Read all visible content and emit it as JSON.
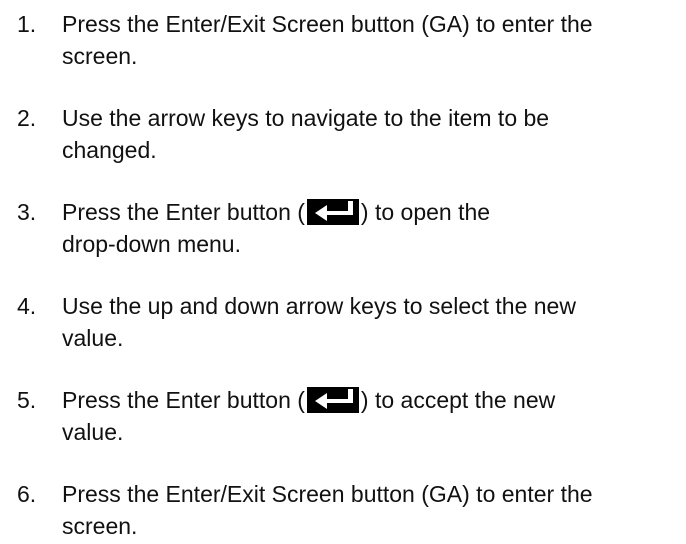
{
  "steps": [
    {
      "number": "1.",
      "lines": [
        "Press the Enter/Exit Screen button (GA) to enter the",
        "screen."
      ]
    },
    {
      "number": "2.",
      "lines": [
        "Use the arrow keys to navigate to the item to be",
        "changed."
      ]
    },
    {
      "number": "3.",
      "before_icon": "Press the Enter button (",
      "after_icon": ") to open the",
      "line2": "drop-down menu.",
      "icon": "enter-key-icon"
    },
    {
      "number": "4.",
      "lines": [
        "Use the up and down arrow keys to select the new",
        "value."
      ]
    },
    {
      "number": "5.",
      "before_icon": "Press the Enter button (",
      "after_icon": ") to accept the new",
      "line2": "value.",
      "icon": "enter-key-icon"
    },
    {
      "number": "6.",
      "lines": [
        "Press the Enter/Exit Screen button (GA) to enter the",
        "screen."
      ]
    }
  ],
  "colors": {
    "text": "#111111",
    "icon_background": "#000000",
    "icon_foreground": "#ffffff"
  }
}
